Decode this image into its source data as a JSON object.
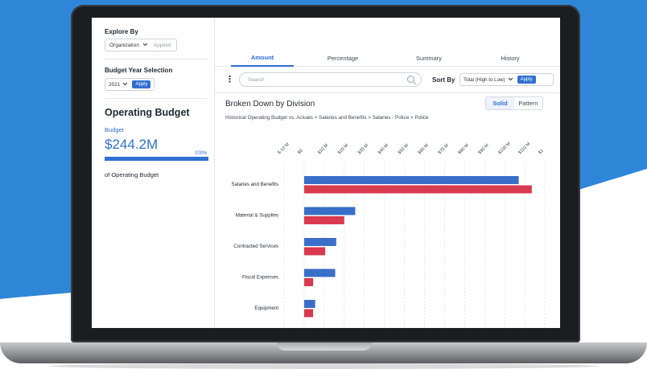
{
  "colors": {
    "background": "#2f86d8",
    "accent": "#2f6fd1",
    "budget_series": "#3a6fc9",
    "actuals_series": "#d83a4f"
  },
  "sidebar": {
    "explore_title": "Explore By",
    "explore_value": "Organization",
    "explore_status": "Applied",
    "budget_year_title": "Budget Year Selection",
    "budget_year_value": "2021",
    "apply_label": "Apply",
    "section_title": "Operating Budget",
    "budget_label": "Budget",
    "budget_value": "$244.2M",
    "percent": "100%",
    "of_label": "of Operating Budget"
  },
  "tabs": [
    {
      "label": "Amount",
      "active": true
    },
    {
      "label": "Percentage",
      "active": false
    },
    {
      "label": "Summary",
      "active": false
    },
    {
      "label": "History",
      "active": false
    }
  ],
  "toolbar": {
    "search_placeholder": "Search",
    "sort_label": "Sort By",
    "sort_value": "Total (High to Low)",
    "apply_label": "Apply"
  },
  "chart_header": {
    "title": "Broken Down by Division",
    "toggle_solid": "Solid",
    "toggle_pattern": "Pattern",
    "breadcrumb": "Historical Operating Budget vs. Actuals  >  Salaries and Benefits  >  Salaries - Police  >  Police"
  },
  "chart_data": {
    "type": "bar",
    "orientation": "horizontal",
    "x_ticks": [
      "$-10 M",
      "$0",
      "$10 M",
      "$20 M",
      "$30 M",
      "$40 M",
      "$50 M",
      "$60 M",
      "$70 M",
      "$80 M",
      "$90 M",
      "$100 M",
      "$110 M",
      "$1"
    ],
    "xlim": [
      -10,
      120
    ],
    "grid": true,
    "categories": [
      "Salaries and Benefits",
      "Material & Supplies",
      "Contracted Services",
      "Fiscal Expenses",
      "Equipment"
    ],
    "series": [
      {
        "color": "#3a6fc9",
        "values": [
          107,
          25.5,
          16,
          15.5,
          5.5
        ]
      },
      {
        "color": "#d83a4f",
        "values": [
          113.5,
          20,
          10.5,
          4.5,
          4.5
        ]
      }
    ]
  }
}
